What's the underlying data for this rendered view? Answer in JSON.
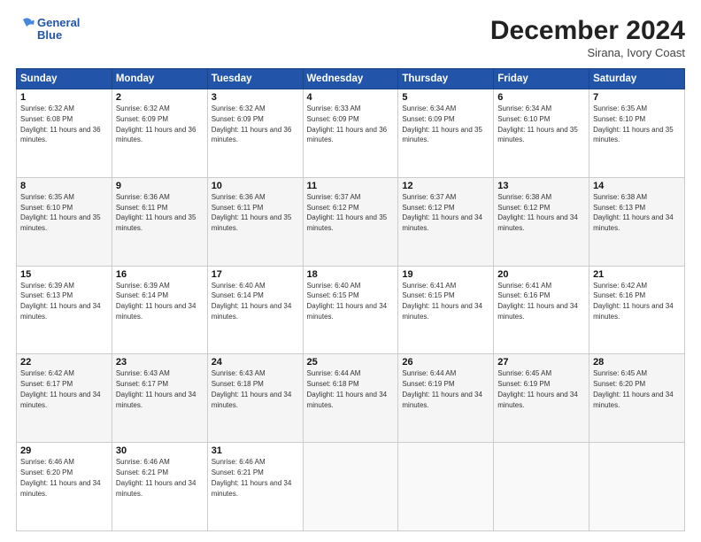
{
  "header": {
    "logo_line1": "General",
    "logo_line2": "Blue",
    "month": "December 2024",
    "location": "Sirana, Ivory Coast"
  },
  "weekdays": [
    "Sunday",
    "Monday",
    "Tuesday",
    "Wednesday",
    "Thursday",
    "Friday",
    "Saturday"
  ],
  "weeks": [
    [
      {
        "day": "1",
        "sunrise": "6:32 AM",
        "sunset": "6:08 PM",
        "daylight": "11 hours and 36 minutes."
      },
      {
        "day": "2",
        "sunrise": "6:32 AM",
        "sunset": "6:09 PM",
        "daylight": "11 hours and 36 minutes."
      },
      {
        "day": "3",
        "sunrise": "6:32 AM",
        "sunset": "6:09 PM",
        "daylight": "11 hours and 36 minutes."
      },
      {
        "day": "4",
        "sunrise": "6:33 AM",
        "sunset": "6:09 PM",
        "daylight": "11 hours and 36 minutes."
      },
      {
        "day": "5",
        "sunrise": "6:34 AM",
        "sunset": "6:09 PM",
        "daylight": "11 hours and 35 minutes."
      },
      {
        "day": "6",
        "sunrise": "6:34 AM",
        "sunset": "6:10 PM",
        "daylight": "11 hours and 35 minutes."
      },
      {
        "day": "7",
        "sunrise": "6:35 AM",
        "sunset": "6:10 PM",
        "daylight": "11 hours and 35 minutes."
      }
    ],
    [
      {
        "day": "8",
        "sunrise": "6:35 AM",
        "sunset": "6:10 PM",
        "daylight": "11 hours and 35 minutes."
      },
      {
        "day": "9",
        "sunrise": "6:36 AM",
        "sunset": "6:11 PM",
        "daylight": "11 hours and 35 minutes."
      },
      {
        "day": "10",
        "sunrise": "6:36 AM",
        "sunset": "6:11 PM",
        "daylight": "11 hours and 35 minutes."
      },
      {
        "day": "11",
        "sunrise": "6:37 AM",
        "sunset": "6:12 PM",
        "daylight": "11 hours and 35 minutes."
      },
      {
        "day": "12",
        "sunrise": "6:37 AM",
        "sunset": "6:12 PM",
        "daylight": "11 hours and 34 minutes."
      },
      {
        "day": "13",
        "sunrise": "6:38 AM",
        "sunset": "6:12 PM",
        "daylight": "11 hours and 34 minutes."
      },
      {
        "day": "14",
        "sunrise": "6:38 AM",
        "sunset": "6:13 PM",
        "daylight": "11 hours and 34 minutes."
      }
    ],
    [
      {
        "day": "15",
        "sunrise": "6:39 AM",
        "sunset": "6:13 PM",
        "daylight": "11 hours and 34 minutes."
      },
      {
        "day": "16",
        "sunrise": "6:39 AM",
        "sunset": "6:14 PM",
        "daylight": "11 hours and 34 minutes."
      },
      {
        "day": "17",
        "sunrise": "6:40 AM",
        "sunset": "6:14 PM",
        "daylight": "11 hours and 34 minutes."
      },
      {
        "day": "18",
        "sunrise": "6:40 AM",
        "sunset": "6:15 PM",
        "daylight": "11 hours and 34 minutes."
      },
      {
        "day": "19",
        "sunrise": "6:41 AM",
        "sunset": "6:15 PM",
        "daylight": "11 hours and 34 minutes."
      },
      {
        "day": "20",
        "sunrise": "6:41 AM",
        "sunset": "6:16 PM",
        "daylight": "11 hours and 34 minutes."
      },
      {
        "day": "21",
        "sunrise": "6:42 AM",
        "sunset": "6:16 PM",
        "daylight": "11 hours and 34 minutes."
      }
    ],
    [
      {
        "day": "22",
        "sunrise": "6:42 AM",
        "sunset": "6:17 PM",
        "daylight": "11 hours and 34 minutes."
      },
      {
        "day": "23",
        "sunrise": "6:43 AM",
        "sunset": "6:17 PM",
        "daylight": "11 hours and 34 minutes."
      },
      {
        "day": "24",
        "sunrise": "6:43 AM",
        "sunset": "6:18 PM",
        "daylight": "11 hours and 34 minutes."
      },
      {
        "day": "25",
        "sunrise": "6:44 AM",
        "sunset": "6:18 PM",
        "daylight": "11 hours and 34 minutes."
      },
      {
        "day": "26",
        "sunrise": "6:44 AM",
        "sunset": "6:19 PM",
        "daylight": "11 hours and 34 minutes."
      },
      {
        "day": "27",
        "sunrise": "6:45 AM",
        "sunset": "6:19 PM",
        "daylight": "11 hours and 34 minutes."
      },
      {
        "day": "28",
        "sunrise": "6:45 AM",
        "sunset": "6:20 PM",
        "daylight": "11 hours and 34 minutes."
      }
    ],
    [
      {
        "day": "29",
        "sunrise": "6:46 AM",
        "sunset": "6:20 PM",
        "daylight": "11 hours and 34 minutes."
      },
      {
        "day": "30",
        "sunrise": "6:46 AM",
        "sunset": "6:21 PM",
        "daylight": "11 hours and 34 minutes."
      },
      {
        "day": "31",
        "sunrise": "6:46 AM",
        "sunset": "6:21 PM",
        "daylight": "11 hours and 34 minutes."
      },
      null,
      null,
      null,
      null
    ]
  ],
  "labels": {
    "sunrise": "Sunrise: ",
    "sunset": "Sunset: ",
    "daylight": "Daylight: "
  }
}
